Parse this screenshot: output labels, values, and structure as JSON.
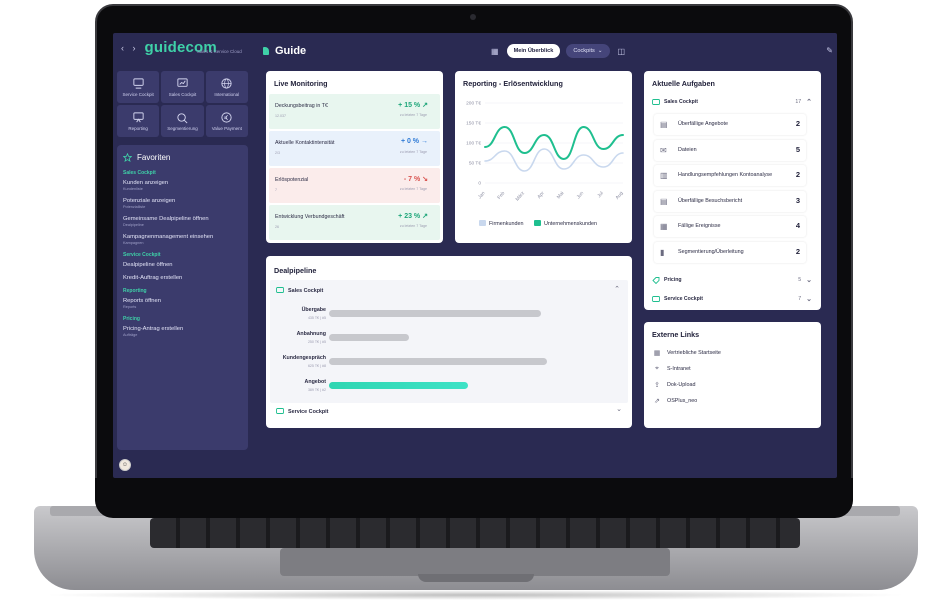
{
  "brand": {
    "logo": "guidecom",
    "subtitle": "Sales & Service Cloud",
    "nav_arrows": "‹ ›"
  },
  "sidebar": {
    "tiles": [
      {
        "label": "Service Cockpit",
        "icon": "service-cockpit-icon"
      },
      {
        "label": "Sales Cockpit",
        "icon": "sales-cockpit-icon"
      },
      {
        "label": "International",
        "icon": "globe-icon"
      },
      {
        "label": "Reporting",
        "icon": "reporting-icon"
      },
      {
        "label": "Segmentierung",
        "icon": "segmentation-icon"
      },
      {
        "label": "Value Payment",
        "icon": "value-payment-icon"
      }
    ],
    "favorites_title": "Favoriten",
    "groups": [
      {
        "name": "Sales Cockpit",
        "items": [
          {
            "label": "Kunden anzeigen",
            "sub": "Kundenliste"
          },
          {
            "label": "Potenziale anzeigen",
            "sub": "Potenzialliste"
          },
          {
            "label": "Gemeinsame Dealpipeline öffnen",
            "sub": "Dealpipeline"
          },
          {
            "label": "Kampagnenmanagement einsehen",
            "sub": "Kampagnen"
          }
        ]
      },
      {
        "name": "Service Cockpit",
        "items": [
          {
            "label": "Dealpipeline öffnen",
            "sub": ""
          },
          {
            "label": "Kredit-Auftrag erstellen",
            "sub": ""
          }
        ]
      },
      {
        "name": "Reporting",
        "items": [
          {
            "label": "Reports öffnen",
            "sub": "Reports"
          }
        ]
      },
      {
        "name": "Pricing",
        "items": [
          {
            "label": "Pricing-Antrag erstellen",
            "sub": "Aufträge"
          }
        ]
      }
    ]
  },
  "header": {
    "title": "Guide",
    "tab_active": "Mein Überblick",
    "dropdown": "Cockpits",
    "dropdown_caret": "⌄"
  },
  "live_monitoring": {
    "title": "Live Monitoring",
    "rows": [
      {
        "label": "Deckungsbeitrag in T€",
        "sub": "12.037",
        "value": "+ 15 %",
        "trend": "↗",
        "compare": "zu letzten 7 Tage",
        "status": "positive"
      },
      {
        "label": "Aktuelle Kontaktintensität",
        "sub": "2/3",
        "value": "+ 0 %",
        "trend": "→",
        "compare": "zu letzten 7 Tage",
        "status": "neutral"
      },
      {
        "label": "Erlöspotenzial",
        "sub": "7",
        "value": "- 7 %",
        "trend": "↘",
        "compare": "zu letzten 7 Tage",
        "status": "negative"
      },
      {
        "label": "Entwicklung Verbundgeschäft",
        "sub": "26",
        "value": "+ 23 %",
        "trend": "↗",
        "compare": "zu letzten 7 Tage",
        "status": "positive"
      }
    ]
  },
  "reporting": {
    "title": "Reporting - Erlösentwicklung"
  },
  "chart_data": {
    "type": "line",
    "title": "Reporting - Erlösentwicklung",
    "categories": [
      "Jan",
      "Feb",
      "März",
      "Apr",
      "Mai",
      "Jun",
      "Jul",
      "Aug"
    ],
    "y_ticks": [
      "200 T€",
      "150 T€",
      "100 T€",
      "50 T€",
      "0"
    ],
    "ylim": [
      0,
      200
    ],
    "series": [
      {
        "name": "Firmenkunden",
        "color": "#c9d8ee",
        "values": [
          55,
          80,
          30,
          85,
          35,
          70,
          40,
          75
        ]
      },
      {
        "name": "Unternehmenskunden",
        "color": "#1fbf8f",
        "values": [
          90,
          140,
          75,
          120,
          60,
          140,
          85,
          120
        ]
      }
    ],
    "grid": true,
    "legend": "bottom"
  },
  "dealpipeline": {
    "title": "Dealpipeline",
    "sales_section": "Sales Cockpit",
    "service_section": "Service Cockpit",
    "bars": [
      {
        "label": "Übergabe",
        "sub": "435 T€ | #5",
        "fraction": 0.72,
        "color": "#c7c8cd"
      },
      {
        "label": "Anbahnung",
        "sub": "250 T€ | #5",
        "fraction": 0.27,
        "color": "#c7c8cd"
      },
      {
        "label": "Kundengespräch",
        "sub": "625 T€ | #8",
        "fraction": 0.74,
        "color": "#c7c8cd"
      },
      {
        "label": "Angebot",
        "sub": "389 T€ | #2",
        "fraction": 0.47,
        "color": "#2fd6b2"
      }
    ]
  },
  "tasks": {
    "title": "Aktuelle Aufgaben",
    "sales_section": {
      "label": "Sales Cockpit",
      "count": "17"
    },
    "items": [
      {
        "label": "Überfällige Angebote",
        "count": "2",
        "icon": "document-icon"
      },
      {
        "label": "Dateien",
        "count": "5",
        "icon": "inbox-icon"
      },
      {
        "label": "Handlungsempfehlungen Kontoanalyse",
        "count": "2",
        "icon": "chart-icon"
      },
      {
        "label": "Überfällige Besuchsbericht",
        "count": "3",
        "icon": "report-icon"
      },
      {
        "label": "Fällige Ereignisse",
        "count": "4",
        "icon": "calendar-icon"
      },
      {
        "label": "Segmentierung/Überleitung",
        "count": "2",
        "icon": "bar-chart-icon"
      }
    ],
    "pricing_section": {
      "label": "Pricing",
      "count": "5"
    },
    "service_section": {
      "label": "Service Cockpit",
      "count": "7"
    }
  },
  "links": {
    "title": "Externe Links",
    "items": [
      {
        "label": "Vertriebliche Startseite",
        "icon": "grid-icon"
      },
      {
        "label": "S-Intranet",
        "icon": "pin-icon"
      },
      {
        "label": "Dok-Upload",
        "icon": "upload-icon"
      },
      {
        "label": "OSPlus_neo",
        "icon": "external-link-icon"
      }
    ]
  },
  "colors": {
    "accent": "#3fd1a8",
    "screen_bg": "#2a2a52",
    "panel_bg": "#3b3b6c"
  }
}
